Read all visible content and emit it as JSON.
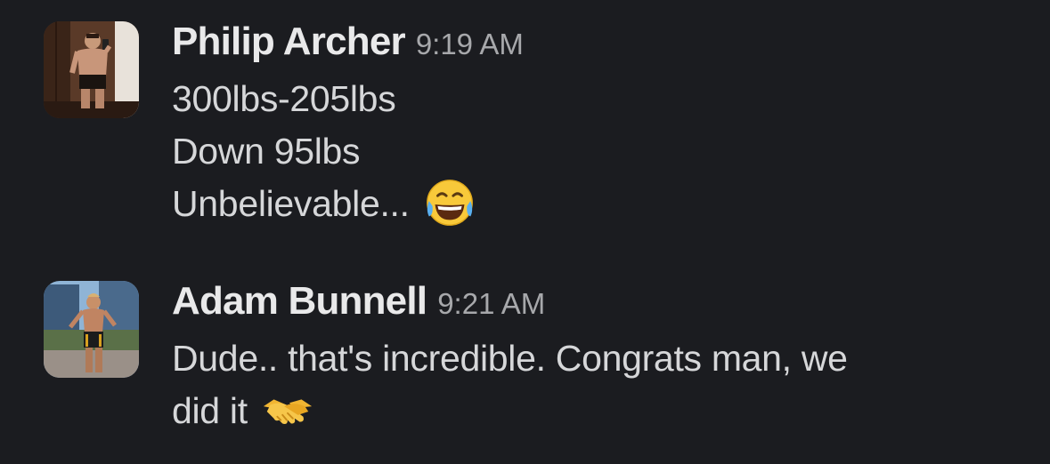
{
  "messages": [
    {
      "sender": "Philip Archer",
      "time": "9:19 AM",
      "avatar_icon": "user-avatar-photo",
      "lines": [
        "300lbs-205lbs",
        "Down 95lbs",
        "Unbelievable..."
      ],
      "emoji": "joy-emoji"
    },
    {
      "sender": "Adam Bunnell",
      "time": "9:21 AM",
      "avatar_icon": "user-avatar-photo",
      "lines": [
        "Dude.. that's incredible. Congrats man, we",
        "did it"
      ],
      "emoji": "handshake-emoji"
    }
  ],
  "colors": {
    "background": "#1b1c20",
    "sender": "#e9e9ea",
    "timestamp": "#a7a8ab",
    "text": "#d6d7d9"
  }
}
